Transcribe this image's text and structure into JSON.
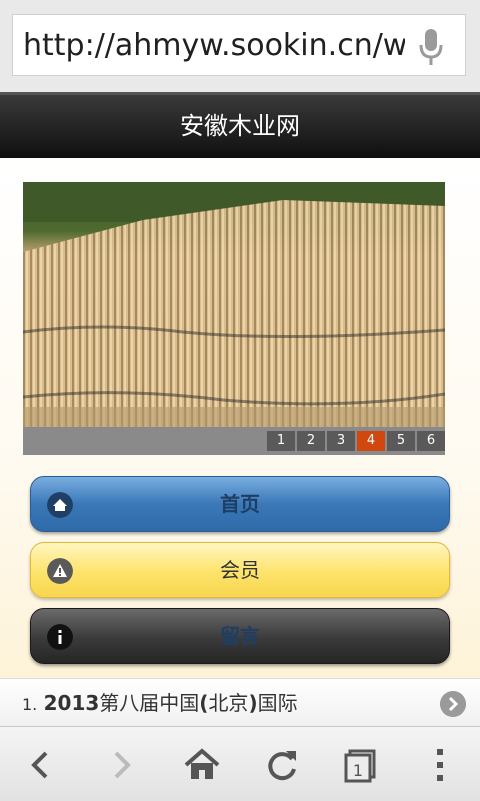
{
  "browser": {
    "url": "http://ahmyw.sookin.cn/wap",
    "mic_icon": "microphone-icon"
  },
  "site": {
    "title": "安徽木业网"
  },
  "slider": {
    "pages": [
      "1",
      "2",
      "3",
      "4",
      "5",
      "6"
    ],
    "active_page": "4"
  },
  "nav": {
    "home": "首页",
    "member": "会员",
    "message": "留言"
  },
  "list": {
    "items": [
      {
        "num": "1.",
        "bold_text": "2013",
        "text_a": "第八届中国",
        "bold_paren_open": "(",
        "text_b": "北京",
        "bold_paren_close": ")",
        "text_c": "国际"
      }
    ]
  },
  "toolbar": {
    "icons": [
      "back-icon",
      "forward-icon",
      "home-icon",
      "reload-icon",
      "tabs-icon",
      "menu-icon"
    ],
    "tab_count": "1"
  },
  "colors": {
    "active_page": "#d04810",
    "home_button": "#3a78b8",
    "member_button": "#fde36a",
    "message_button": "#3a3a3a"
  }
}
